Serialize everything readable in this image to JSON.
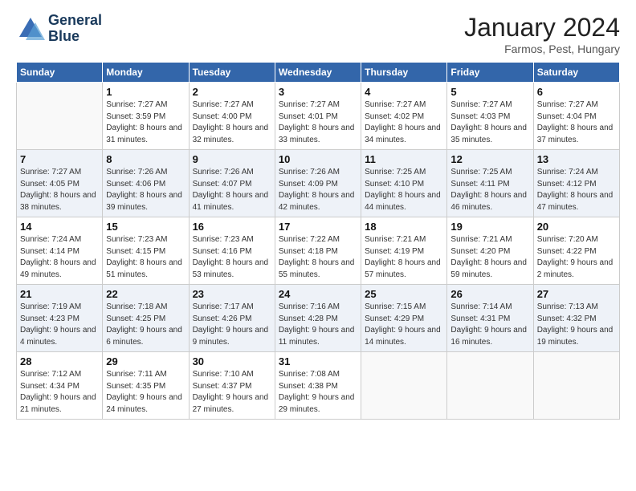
{
  "logo": {
    "line1": "General",
    "line2": "Blue"
  },
  "title": "January 2024",
  "subtitle": "Farmos, Pest, Hungary",
  "weekdays": [
    "Sunday",
    "Monday",
    "Tuesday",
    "Wednesday",
    "Thursday",
    "Friday",
    "Saturday"
  ],
  "weeks": [
    [
      {
        "day": "",
        "sunrise": "",
        "sunset": "",
        "daylight": ""
      },
      {
        "day": "1",
        "sunrise": "Sunrise: 7:27 AM",
        "sunset": "Sunset: 3:59 PM",
        "daylight": "Daylight: 8 hours and 31 minutes."
      },
      {
        "day": "2",
        "sunrise": "Sunrise: 7:27 AM",
        "sunset": "Sunset: 4:00 PM",
        "daylight": "Daylight: 8 hours and 32 minutes."
      },
      {
        "day": "3",
        "sunrise": "Sunrise: 7:27 AM",
        "sunset": "Sunset: 4:01 PM",
        "daylight": "Daylight: 8 hours and 33 minutes."
      },
      {
        "day": "4",
        "sunrise": "Sunrise: 7:27 AM",
        "sunset": "Sunset: 4:02 PM",
        "daylight": "Daylight: 8 hours and 34 minutes."
      },
      {
        "day": "5",
        "sunrise": "Sunrise: 7:27 AM",
        "sunset": "Sunset: 4:03 PM",
        "daylight": "Daylight: 8 hours and 35 minutes."
      },
      {
        "day": "6",
        "sunrise": "Sunrise: 7:27 AM",
        "sunset": "Sunset: 4:04 PM",
        "daylight": "Daylight: 8 hours and 37 minutes."
      }
    ],
    [
      {
        "day": "7",
        "sunrise": "Sunrise: 7:27 AM",
        "sunset": "Sunset: 4:05 PM",
        "daylight": "Daylight: 8 hours and 38 minutes."
      },
      {
        "day": "8",
        "sunrise": "Sunrise: 7:26 AM",
        "sunset": "Sunset: 4:06 PM",
        "daylight": "Daylight: 8 hours and 39 minutes."
      },
      {
        "day": "9",
        "sunrise": "Sunrise: 7:26 AM",
        "sunset": "Sunset: 4:07 PM",
        "daylight": "Daylight: 8 hours and 41 minutes."
      },
      {
        "day": "10",
        "sunrise": "Sunrise: 7:26 AM",
        "sunset": "Sunset: 4:09 PM",
        "daylight": "Daylight: 8 hours and 42 minutes."
      },
      {
        "day": "11",
        "sunrise": "Sunrise: 7:25 AM",
        "sunset": "Sunset: 4:10 PM",
        "daylight": "Daylight: 8 hours and 44 minutes."
      },
      {
        "day": "12",
        "sunrise": "Sunrise: 7:25 AM",
        "sunset": "Sunset: 4:11 PM",
        "daylight": "Daylight: 8 hours and 46 minutes."
      },
      {
        "day": "13",
        "sunrise": "Sunrise: 7:24 AM",
        "sunset": "Sunset: 4:12 PM",
        "daylight": "Daylight: 8 hours and 47 minutes."
      }
    ],
    [
      {
        "day": "14",
        "sunrise": "Sunrise: 7:24 AM",
        "sunset": "Sunset: 4:14 PM",
        "daylight": "Daylight: 8 hours and 49 minutes."
      },
      {
        "day": "15",
        "sunrise": "Sunrise: 7:23 AM",
        "sunset": "Sunset: 4:15 PM",
        "daylight": "Daylight: 8 hours and 51 minutes."
      },
      {
        "day": "16",
        "sunrise": "Sunrise: 7:23 AM",
        "sunset": "Sunset: 4:16 PM",
        "daylight": "Daylight: 8 hours and 53 minutes."
      },
      {
        "day": "17",
        "sunrise": "Sunrise: 7:22 AM",
        "sunset": "Sunset: 4:18 PM",
        "daylight": "Daylight: 8 hours and 55 minutes."
      },
      {
        "day": "18",
        "sunrise": "Sunrise: 7:21 AM",
        "sunset": "Sunset: 4:19 PM",
        "daylight": "Daylight: 8 hours and 57 minutes."
      },
      {
        "day": "19",
        "sunrise": "Sunrise: 7:21 AM",
        "sunset": "Sunset: 4:20 PM",
        "daylight": "Daylight: 8 hours and 59 minutes."
      },
      {
        "day": "20",
        "sunrise": "Sunrise: 7:20 AM",
        "sunset": "Sunset: 4:22 PM",
        "daylight": "Daylight: 9 hours and 2 minutes."
      }
    ],
    [
      {
        "day": "21",
        "sunrise": "Sunrise: 7:19 AM",
        "sunset": "Sunset: 4:23 PM",
        "daylight": "Daylight: 9 hours and 4 minutes."
      },
      {
        "day": "22",
        "sunrise": "Sunrise: 7:18 AM",
        "sunset": "Sunset: 4:25 PM",
        "daylight": "Daylight: 9 hours and 6 minutes."
      },
      {
        "day": "23",
        "sunrise": "Sunrise: 7:17 AM",
        "sunset": "Sunset: 4:26 PM",
        "daylight": "Daylight: 9 hours and 9 minutes."
      },
      {
        "day": "24",
        "sunrise": "Sunrise: 7:16 AM",
        "sunset": "Sunset: 4:28 PM",
        "daylight": "Daylight: 9 hours and 11 minutes."
      },
      {
        "day": "25",
        "sunrise": "Sunrise: 7:15 AM",
        "sunset": "Sunset: 4:29 PM",
        "daylight": "Daylight: 9 hours and 14 minutes."
      },
      {
        "day": "26",
        "sunrise": "Sunrise: 7:14 AM",
        "sunset": "Sunset: 4:31 PM",
        "daylight": "Daylight: 9 hours and 16 minutes."
      },
      {
        "day": "27",
        "sunrise": "Sunrise: 7:13 AM",
        "sunset": "Sunset: 4:32 PM",
        "daylight": "Daylight: 9 hours and 19 minutes."
      }
    ],
    [
      {
        "day": "28",
        "sunrise": "Sunrise: 7:12 AM",
        "sunset": "Sunset: 4:34 PM",
        "daylight": "Daylight: 9 hours and 21 minutes."
      },
      {
        "day": "29",
        "sunrise": "Sunrise: 7:11 AM",
        "sunset": "Sunset: 4:35 PM",
        "daylight": "Daylight: 9 hours and 24 minutes."
      },
      {
        "day": "30",
        "sunrise": "Sunrise: 7:10 AM",
        "sunset": "Sunset: 4:37 PM",
        "daylight": "Daylight: 9 hours and 27 minutes."
      },
      {
        "day": "31",
        "sunrise": "Sunrise: 7:08 AM",
        "sunset": "Sunset: 4:38 PM",
        "daylight": "Daylight: 9 hours and 29 minutes."
      },
      {
        "day": "",
        "sunrise": "",
        "sunset": "",
        "daylight": ""
      },
      {
        "day": "",
        "sunrise": "",
        "sunset": "",
        "daylight": ""
      },
      {
        "day": "",
        "sunrise": "",
        "sunset": "",
        "daylight": ""
      }
    ]
  ]
}
